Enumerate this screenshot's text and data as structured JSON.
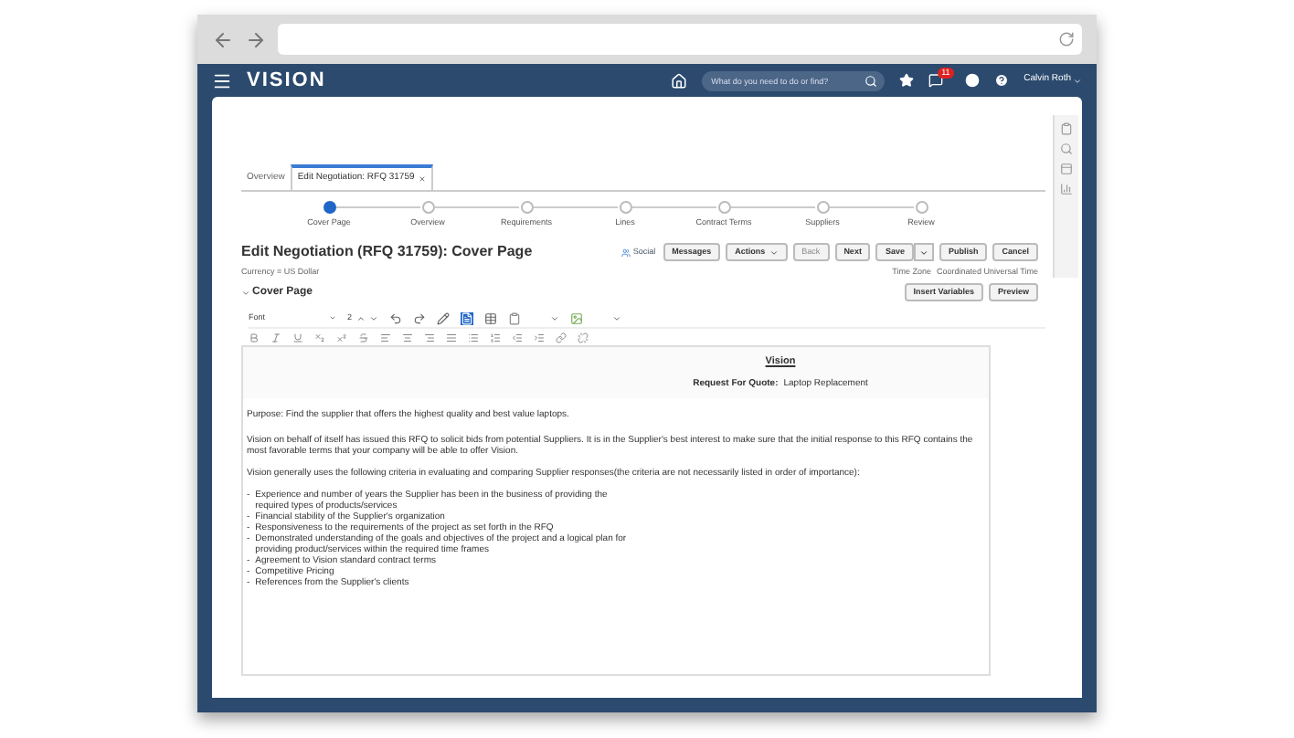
{
  "header": {
    "logo": "VISION",
    "search": {
      "placeholder": "What do you need to do or find?"
    },
    "notification_count": "11",
    "user": "Calvin Roth"
  },
  "tabs": [
    {
      "label": "Overview",
      "selected": false,
      "closable": false
    },
    {
      "label": "Edit Negotiation: RFQ 31759",
      "selected": true,
      "closable": true
    }
  ],
  "steps": [
    {
      "label": "Cover Page",
      "selected": true
    },
    {
      "label": "Overview",
      "selected": false
    },
    {
      "label": "Requirements",
      "selected": false
    },
    {
      "label": "Lines",
      "selected": false
    },
    {
      "label": "Contract Terms",
      "selected": false
    },
    {
      "label": "Suppliers",
      "selected": false
    },
    {
      "label": "Review",
      "selected": false
    }
  ],
  "title": "Edit Negotiation (RFQ 31759): Cover Page",
  "social": "Social",
  "actions": [
    {
      "label": "Messages",
      "kind": "button",
      "disabled": false
    },
    {
      "label": "Actions",
      "kind": "menu",
      "disabled": false
    },
    {
      "label": "Back",
      "kind": "button",
      "disabled": true
    },
    {
      "label": "Next",
      "kind": "button",
      "disabled": false
    },
    {
      "label": "Save",
      "kind": "split",
      "disabled": false
    },
    {
      "label": "Publish",
      "kind": "button",
      "disabled": false
    },
    {
      "label": "Cancel",
      "kind": "button",
      "disabled": false
    }
  ],
  "currency": "Currency = US Dollar",
  "time_zone_label": "Time Zone",
  "time_zone": "Coordinated Universal Time",
  "section": "Cover Page",
  "section_buttons": [
    "Insert Variables",
    "Preview"
  ],
  "editor": {
    "font": "Font",
    "size": "2",
    "document": {
      "heading": "Vision",
      "rfq_label": "Request For Quote:",
      "rfq_value": "Laptop Replacement",
      "purpose": "Purpose: Find the supplier that offers the highest quality and best value laptops.",
      "intro": "Vision on behalf of itself  has issued this RFQ to solicit bids from potential Suppliers. It is in the Supplier's best interest to make sure that the initial response to this RFQ contains the  most favorable terms that your company will be able to offer Vision.",
      "criteria_intro": "Vision generally uses the following criteria in evaluating and comparing Supplier responses(the criteria are not necessarily listed in order of importance):",
      "criteria": [
        {
          "marker": "-",
          "text": "Experience and number of years the Supplier has been in the business of providing the required types of products/services"
        },
        {
          "marker": "-",
          "text": "Financial stability of the Supplier's organization"
        },
        {
          "marker": "-",
          "text": "Responsiveness to the requirements of the project as set forth in the RFQ"
        },
        {
          "marker": "-",
          "text": "Demonstrated understanding of the goals and objectives of the project and a logical plan for providing product/services within the required time frames"
        },
        {
          "marker": "-",
          "text": "Agreement to Vision standard contract terms"
        },
        {
          "marker": "-",
          "text": "Competitive Pricing"
        },
        {
          "marker": "-",
          "text": "References from the Supplier's clients"
        }
      ]
    }
  }
}
